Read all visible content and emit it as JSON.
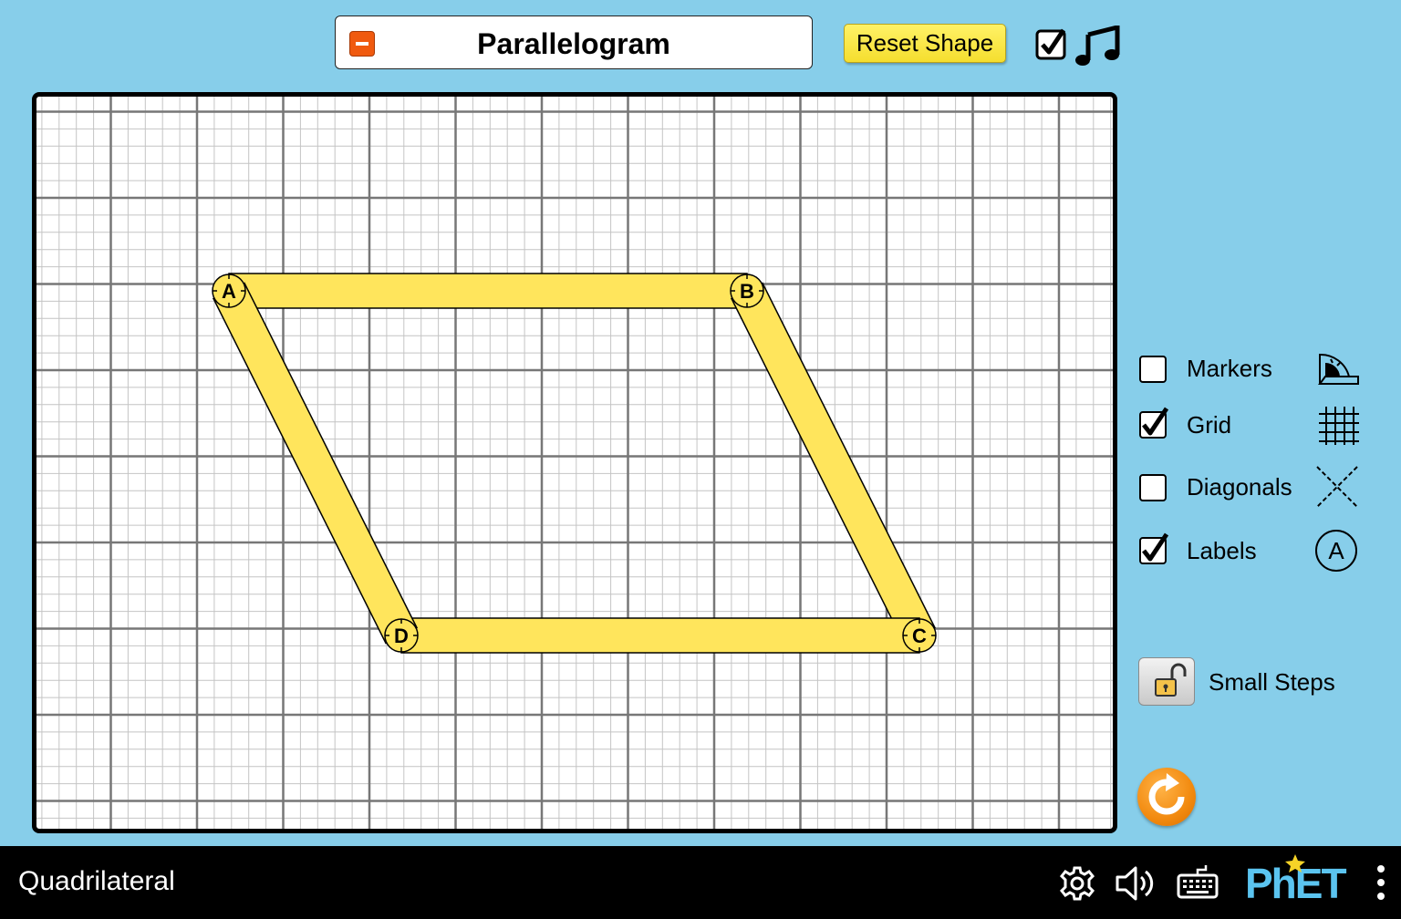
{
  "header": {
    "shape_name": "Parallelogram",
    "reset_shape_label": "Reset Shape"
  },
  "board": {
    "vertices": [
      {
        "label": "A"
      },
      {
        "label": "B"
      },
      {
        "label": "C"
      },
      {
        "label": "D"
      }
    ],
    "side_color": "#ffe55c",
    "vertex_color": "#ffe55c"
  },
  "controls": {
    "checkboxes": [
      {
        "label": "Markers",
        "checked": false,
        "icon": "protractor-icon"
      },
      {
        "label": "Grid",
        "checked": true,
        "icon": "grid-icon"
      },
      {
        "label": "Diagonals",
        "checked": false,
        "icon": "diagonals-icon"
      },
      {
        "label": "Labels",
        "checked": true,
        "icon": "label-circle-icon"
      }
    ],
    "labels_icon_text": "A",
    "small_steps_label": "Small Steps"
  },
  "navbar": {
    "sim_title": "Quadrilateral",
    "logo_text": "PhET"
  },
  "colors": {
    "background": "#87ceea",
    "reset_all": "#f28a0f",
    "shape_fill": "#ffe55c",
    "collapse_button": "#f05a0f"
  }
}
